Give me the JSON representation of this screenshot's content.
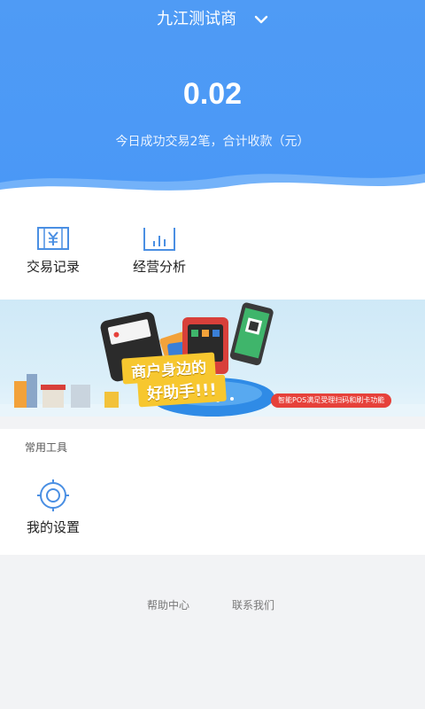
{
  "header": {
    "merchant_name": "九江测试商",
    "today_amount": "0.02",
    "summary": "今日成功交易2笔，合计收款（元）"
  },
  "actions": [
    {
      "label": "交易记录",
      "icon": "yuan-ledger-icon"
    },
    {
      "label": "经营分析",
      "icon": "bar-chart-icon"
    }
  ],
  "banner": {
    "headline_1": "商户身边的",
    "headline_2": "好助手!!!",
    "tagline": "智能POS满足受理扫码和刷卡功能"
  },
  "tools": {
    "section_title": "常用工具",
    "items": [
      {
        "label": "我的设置",
        "icon": "settings-icon"
      }
    ]
  },
  "footer": {
    "help": "帮助中心",
    "contact": "联系我们"
  },
  "colors": {
    "header_blue": "#4f9bf5",
    "icon_blue": "#4a8fe3",
    "banner_tag_red": "#e6413a",
    "banner_yellow": "#f7c72f"
  }
}
